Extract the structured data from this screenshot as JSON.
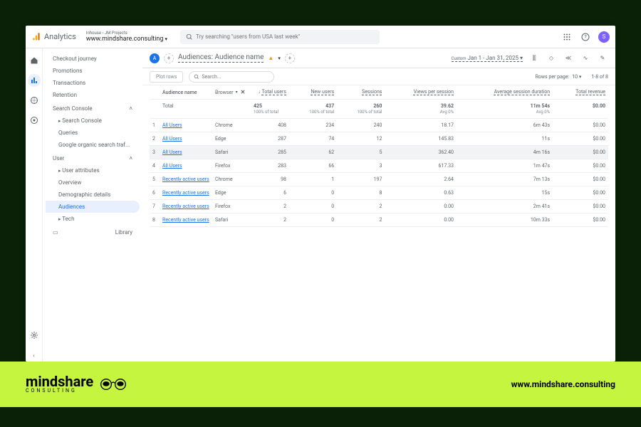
{
  "header": {
    "product": "Analytics",
    "breadcrumb": "Inhouse › JM Projects",
    "property": "www.mindshare.consulting",
    "searchPlaceholder": "Try searching \"users from USA last week\"",
    "avatar": "S"
  },
  "sidebar": {
    "items": {
      "checkout": "Checkout journey",
      "promotions": "Promotions",
      "transactions": "Transactions",
      "retention": "Retention"
    },
    "searchConsole": {
      "label": "Search Console",
      "child": "Search Console",
      "queries": "Queries",
      "organic": "Google organic search traf..."
    },
    "user": {
      "label": "User",
      "attributes": "User attributes",
      "overview": "Overview",
      "demo": "Demographic details",
      "audiences": "Audiences",
      "tech": "Tech"
    },
    "library": "Library"
  },
  "tbar": {
    "title": "Audiences: Audience name",
    "dateLabel": "Custom",
    "dateRange": "Jan 1 - Jan 31, 2025"
  },
  "toolbar": {
    "plot": "Plot rows",
    "searchPlaceholder": "Search...",
    "rowsLabel": "Rows per page:",
    "rowsValue": "10",
    "range": "1-8 of 8"
  },
  "table": {
    "dimLabel": "Audience name",
    "dimBrowser": "Browser",
    "cols": {
      "totalUsers": "Total users",
      "newUsers": "New users",
      "sessions": "Sessions",
      "vps": "Views per session",
      "asd": "Average session duration",
      "rev": "Total revenue"
    },
    "totalRow": {
      "label": "Total",
      "totalUsers": "425",
      "totalUsersSub": "100% of total",
      "newUsers": "437",
      "newUsersSub": "100% of total",
      "sessions": "260",
      "sessionsSub": "100% of total",
      "vps": "39.62",
      "vpsSub": "Avg 0%",
      "asd": "11m 54s",
      "asdSub": "Avg 0%",
      "rev": "$0.00"
    },
    "rows": [
      {
        "n": "1",
        "aud": "All Users",
        "browser": "Chrome",
        "tu": "408",
        "nu": "234",
        "s": "240",
        "vps": "18.17",
        "asd": "6m 43s",
        "rev": "$0.00"
      },
      {
        "n": "2",
        "aud": "All Users",
        "browser": "Edge",
        "tu": "287",
        "nu": "74",
        "s": "12",
        "vps": "145.83",
        "asd": "11s",
        "rev": "$0.00"
      },
      {
        "n": "3",
        "aud": "All Users",
        "browser": "Safari",
        "tu": "285",
        "nu": "62",
        "s": "5",
        "vps": "362.40",
        "asd": "4m 16s",
        "rev": "$0.00",
        "sel": true
      },
      {
        "n": "4",
        "aud": "All Users",
        "browser": "Firefox",
        "tu": "283",
        "nu": "66",
        "s": "3",
        "vps": "617.33",
        "asd": "1m 47s",
        "rev": "$0.00"
      },
      {
        "n": "5",
        "aud": "Recently active users",
        "browser": "Chrome",
        "tu": "98",
        "nu": "1",
        "s": "197",
        "vps": "2.64",
        "asd": "7m 13s",
        "rev": "$0.00"
      },
      {
        "n": "6",
        "aud": "Recently active users",
        "browser": "Edge",
        "tu": "6",
        "nu": "0",
        "s": "8",
        "vps": "0.63",
        "asd": "15s",
        "rev": "$0.00"
      },
      {
        "n": "7",
        "aud": "Recently active users",
        "browser": "Firefox",
        "tu": "2",
        "nu": "0",
        "s": "2",
        "vps": "0.00",
        "asd": "2m 41s",
        "rev": "$0.00"
      },
      {
        "n": "8",
        "aud": "Recently active users",
        "browser": "Safari",
        "tu": "2",
        "nu": "0",
        "s": "2",
        "vps": "0.00",
        "asd": "10m 33s",
        "rev": "$0.00"
      }
    ]
  },
  "footer": {
    "brand": "mindshare",
    "sub": "CONSULTING",
    "url": "www.mindshare.consulting"
  }
}
